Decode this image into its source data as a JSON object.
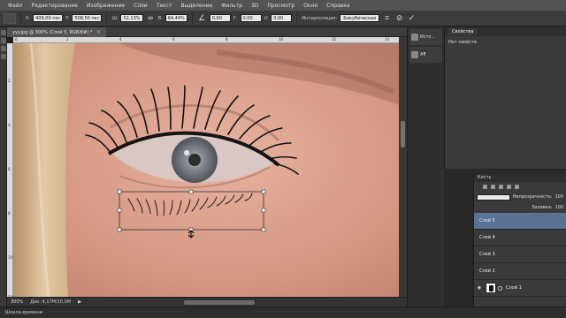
{
  "menu": [
    "Файл",
    "Редактирование",
    "Изображение",
    "Слои",
    "Текст",
    "Выделение",
    "Фильтр",
    "3D",
    "Просмотр",
    "Окно",
    "Справка"
  ],
  "options": {
    "x_label": "X:",
    "x_value": "409,00 пкс",
    "y_label": "Y:",
    "y_value": "508,50 пкс",
    "w_label": "Ш:",
    "w_value": "52,13%",
    "h_label": "В:",
    "h_value": "64,44%",
    "angle_value": "0,00",
    "hskew_label": "Г:",
    "hskew_value": "0,00",
    "vskew_label": "V:",
    "vskew_value": "0,00",
    "interp_label": "Интерполяция:",
    "interp_value": "Бикубическая",
    "cancel_icon": "cancel-icon",
    "commit_icon": "checkmark-icon"
  },
  "document": {
    "tab_title": "yyy.jpg @ 300% (Слой 5, RGB/8#) *",
    "close_glyph": "×",
    "ruler_top": [
      "0",
      "2",
      "4",
      "6",
      "8",
      "10",
      "12",
      "14"
    ],
    "ruler_left": [
      "2",
      "4",
      "6",
      "8",
      "10",
      "12"
    ]
  },
  "status": {
    "zoom": "300%",
    "doc": "Док: 4,17M/10,0M",
    "arrow": "▶"
  },
  "timeline": {
    "label": "Шкала времени"
  },
  "dock": [
    {
      "icon": "history-icon",
      "label": "Исто..."
    },
    {
      "icon": "actions-icon",
      "label": "A¶"
    }
  ],
  "properties": {
    "tab": "Свойства",
    "body": "Нет свойств"
  },
  "layers_panel": {
    "header": "Кисть",
    "opacity_label": "Непрозрачность:",
    "opacity_value": "100",
    "fill_label": "Заливка:",
    "fill_value": "100",
    "layers": [
      {
        "name": "Слой 5",
        "selected": true
      },
      {
        "name": "Слой 4",
        "selected": false
      },
      {
        "name": "Слой 3",
        "selected": false
      },
      {
        "name": "Слой 2",
        "selected": false
      },
      {
        "name": "Слой 1",
        "selected": false
      }
    ]
  },
  "colors": {
    "accent_selected_layer": "#5a7296",
    "ui_dark": "#2f2f2f",
    "skin": "#d89c86"
  }
}
